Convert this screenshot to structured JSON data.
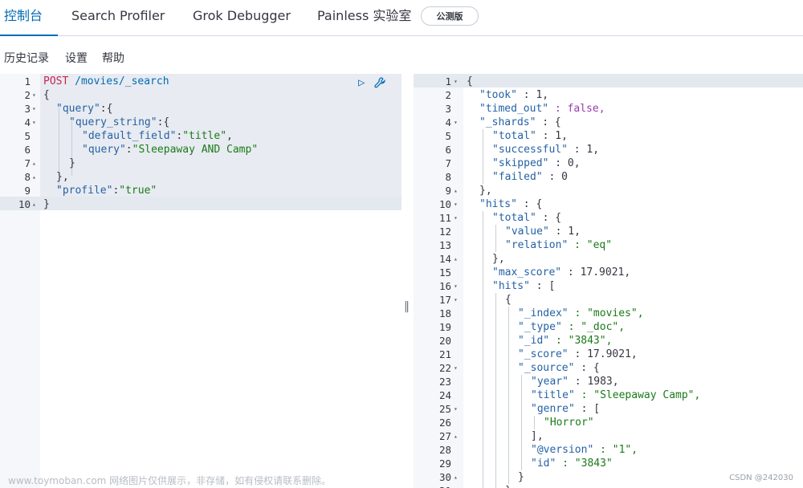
{
  "tabs": [
    {
      "label": "控制台"
    },
    {
      "label": "Search Profiler"
    },
    {
      "label": "Grok Debugger"
    },
    {
      "label": "Painless 实验室"
    }
  ],
  "beta_badge": "公测版",
  "menu": {
    "history": "历史记录",
    "settings": "设置",
    "help": "帮助"
  },
  "icons": {
    "run": "play-icon",
    "wrench": "wrench-icon",
    "grip": "resize-handle-icon"
  },
  "request": {
    "line_numbers": [
      "1",
      "2",
      "3",
      "4",
      "5",
      "6",
      "7",
      "8",
      "9",
      "10"
    ],
    "method": "POST",
    "url": "/movies/_search",
    "l2": "{",
    "l3_key": "\"query\"",
    "l3_rest": ":{",
    "l4_key": "\"query_string\"",
    "l4_rest": ":{",
    "l5_key": "\"default_field\"",
    "l5_colon": ":",
    "l5_val": "\"title\"",
    "l5_comma": ",",
    "l6_key": "\"query\"",
    "l6_colon": ":",
    "l6_val": "\"Sleepaway AND Camp\"",
    "l7": "}",
    "l8": "},",
    "l9_key": "\"profile\"",
    "l9_colon": ":",
    "l9_val": "\"true\"",
    "l10": "}"
  },
  "response": {
    "line_numbers": [
      "1",
      "2",
      "3",
      "4",
      "5",
      "6",
      "7",
      "8",
      "9",
      "10",
      "11",
      "12",
      "13",
      "14",
      "15",
      "16",
      "17",
      "18",
      "19",
      "20",
      "21",
      "22",
      "23",
      "24",
      "25",
      "26",
      "27",
      "28",
      "29",
      "30",
      "31"
    ],
    "lines": [
      {
        "k": "",
        "v": "{"
      },
      {
        "k": "\"took\"",
        "v": " : 1,"
      },
      {
        "k": "\"timed_out\"",
        "v": " : false,"
      },
      {
        "k": "\"_shards\"",
        "v": " : {"
      },
      {
        "k": "\"total\"",
        "v": " : 1,"
      },
      {
        "k": "\"successful\"",
        "v": " : 1,"
      },
      {
        "k": "\"skipped\"",
        "v": " : 0,"
      },
      {
        "k": "\"failed\"",
        "v": " : 0"
      },
      {
        "k": "",
        "v": "},"
      },
      {
        "k": "\"hits\"",
        "v": " : {"
      },
      {
        "k": "\"total\"",
        "v": " : {"
      },
      {
        "k": "\"value\"",
        "v": " : 1,"
      },
      {
        "k": "\"relation\"",
        "v": " : \"eq\""
      },
      {
        "k": "",
        "v": "},"
      },
      {
        "k": "\"max_score\"",
        "v": " : 17.9021,"
      },
      {
        "k": "\"hits\"",
        "v": " : ["
      },
      {
        "k": "",
        "v": "{"
      },
      {
        "k": "\"_index\"",
        "v": " : \"movies\","
      },
      {
        "k": "\"_type\"",
        "v": " : \"_doc\","
      },
      {
        "k": "\"_id\"",
        "v": " : \"3843\","
      },
      {
        "k": "\"_score\"",
        "v": " : 17.9021,"
      },
      {
        "k": "\"_source\"",
        "v": " : {"
      },
      {
        "k": "\"year\"",
        "v": " : 1983,"
      },
      {
        "k": "\"title\"",
        "v": " : \"Sleepaway Camp\","
      },
      {
        "k": "\"genre\"",
        "v": " : ["
      },
      {
        "k": "",
        "v": "\"Horror\""
      },
      {
        "k": "",
        "v": "],"
      },
      {
        "k": "\"@version\"",
        "v": " : \"1\","
      },
      {
        "k": "\"id\"",
        "v": " : \"3843\""
      },
      {
        "k": "",
        "v": "}"
      },
      {
        "k": "",
        "v": "}"
      }
    ]
  },
  "watermark": "www.toymoban.com 网络图片仅供展示，非存储，如有侵权请联系删除。",
  "credit": "CSDN @242030"
}
